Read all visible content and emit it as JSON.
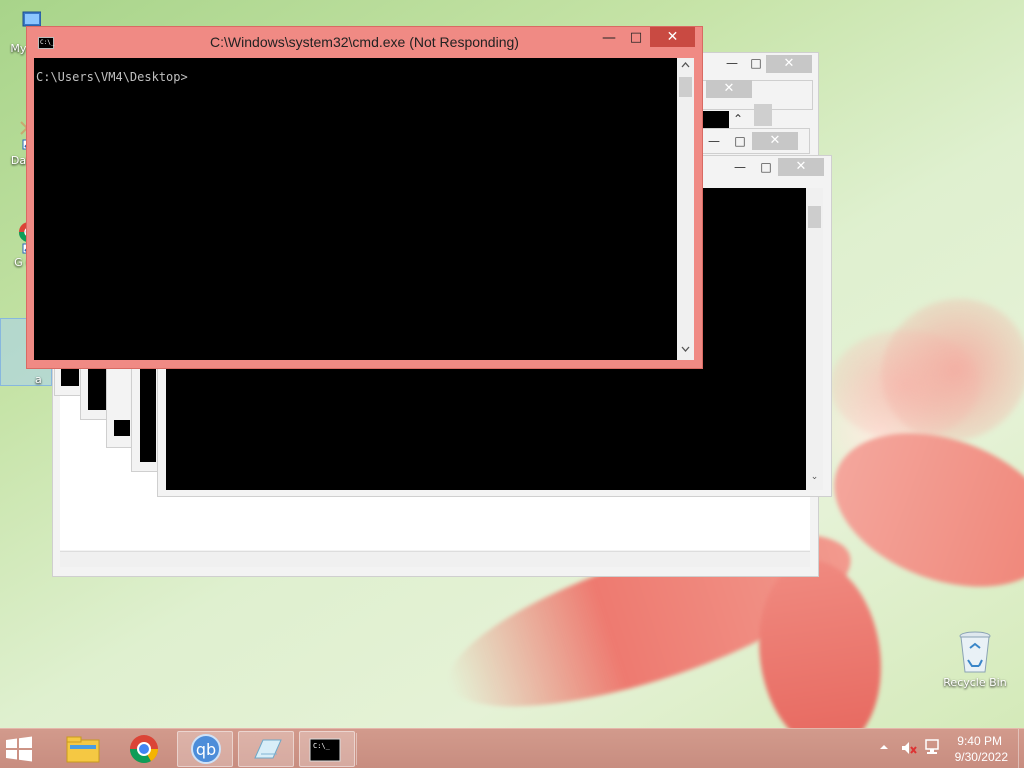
{
  "window": {
    "title": "C:\\Windows\\system32\\cmd.exe (Not Responding)",
    "minimize_glyph": "—",
    "maximize_glyph": "□",
    "close_glyph": "✕",
    "sys_icon_text": "C:\\_",
    "prompt": "C:\\Users\\VM4\\Desktop>"
  },
  "desktop": {
    "icons": [
      {
        "label": "My C",
        "icon": "computer-icon"
      },
      {
        "label": "Data",
        "icon": "data-shortcut-icon"
      },
      {
        "label": "G C",
        "icon": "chrome-shortcut-icon"
      },
      {
        "label": "a",
        "icon": "file-icon"
      },
      {
        "label": "Recycle Bin",
        "icon": "recycle-bin-icon"
      }
    ]
  },
  "taskbar": {
    "items": [
      "start-icon",
      "file-explorer-icon",
      "chrome-icon",
      "qbittorrent-icon",
      "notepad-icon",
      "cmd-icon"
    ],
    "qb_text": "qb",
    "cmd_text": "C:\\_",
    "tray_icons": [
      "show-hidden-icons-arrow",
      "volume-muted-icon",
      "network-icon"
    ],
    "time": "9:40 PM",
    "date": "9/30/2022"
  },
  "colors": {
    "title_bar": "#f08a84",
    "close_button": "#c94a42",
    "taskbar": "#c88d80",
    "console_bg": "#000000",
    "console_text": "#c0c0c0"
  }
}
